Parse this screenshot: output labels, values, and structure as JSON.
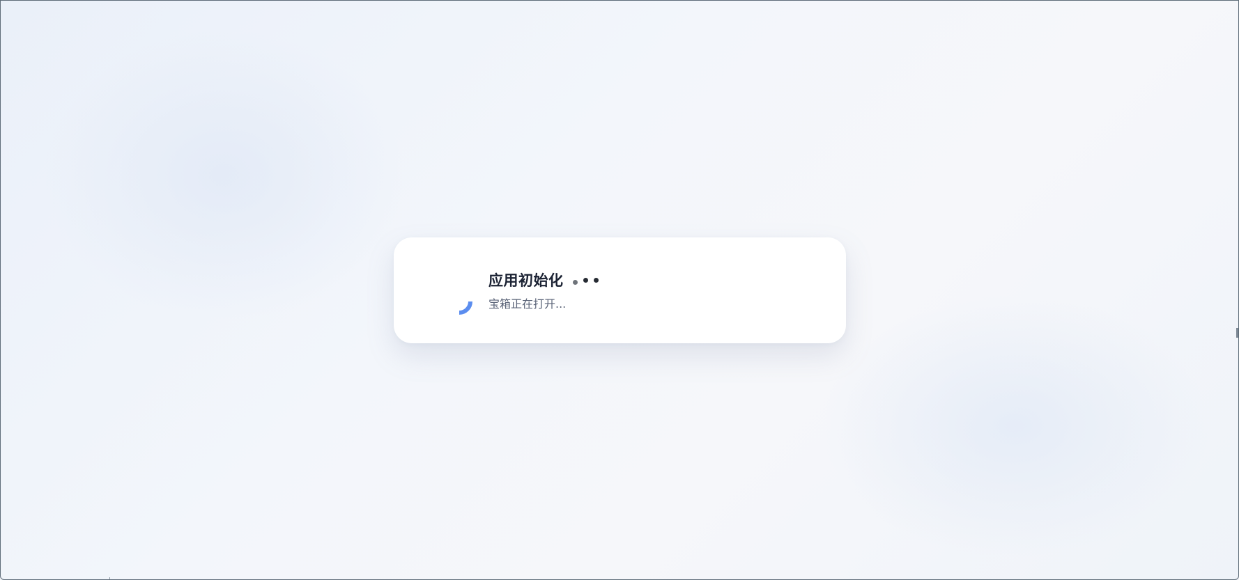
{
  "loading": {
    "title": "应用初始化",
    "subtitle": "宝箱正在打开...",
    "spinner_icon": "loading-spinner-icon",
    "dots_icon": "ellipsis-dots-icon"
  },
  "colors": {
    "accent": "#5b8def",
    "title": "#1b2233",
    "subtitle": "#5b6478",
    "card": "#ffffff",
    "background": "#f2f5fa"
  }
}
